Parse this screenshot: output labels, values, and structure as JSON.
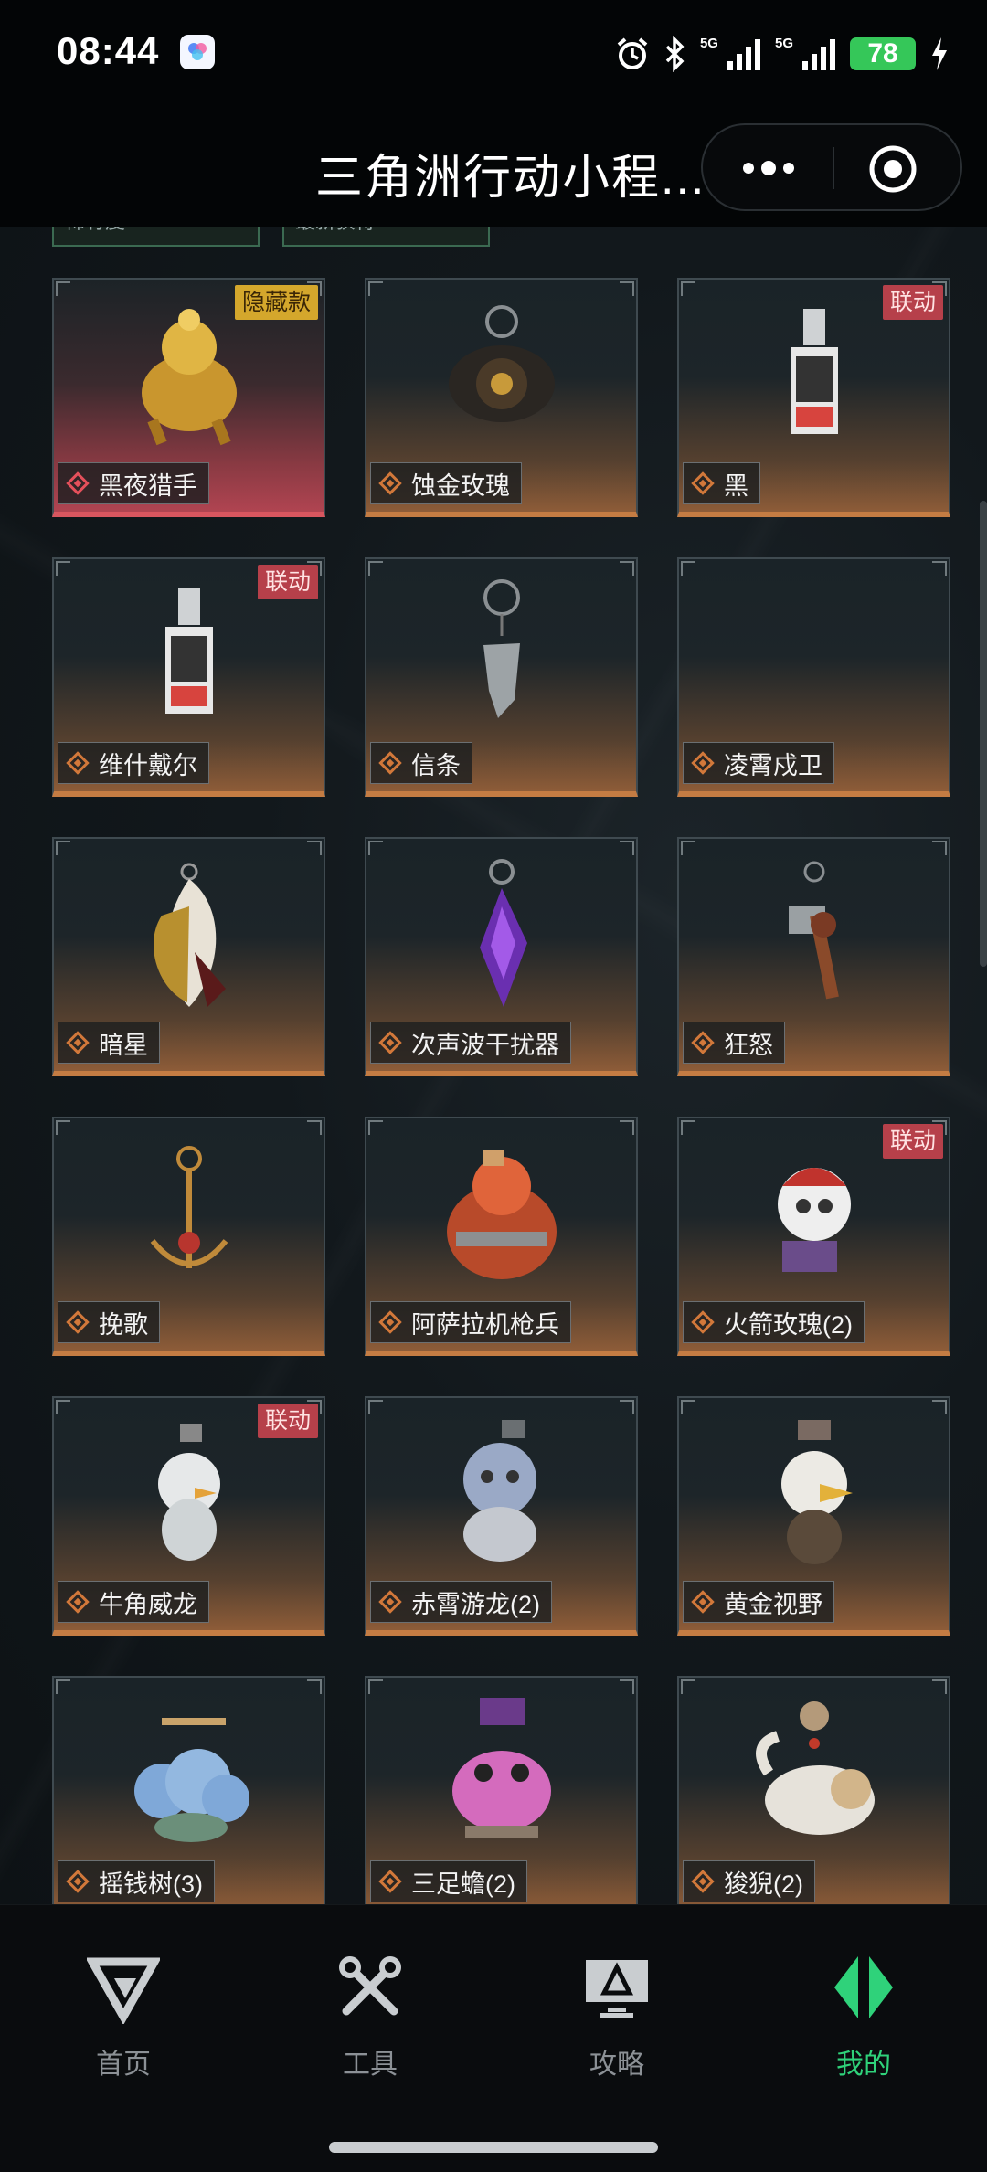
{
  "status_bar": {
    "time": "08:44",
    "battery": "78",
    "net1": "5G",
    "net2": "5G"
  },
  "title_bar": {
    "title": "三角洲行动小程..."
  },
  "filters": [
    "稀有度",
    "最新获得"
  ],
  "items": [
    {
      "name": "黑夜猎手",
      "tag": "隐藏款",
      "tag_type": "hidden",
      "rarity": "red",
      "art": "gold-lion-icon"
    },
    {
      "name": "蚀金玫瑰",
      "tag": "",
      "tag_type": "",
      "rarity": "orange",
      "art": "rose-pendant-icon"
    },
    {
      "name": "黑",
      "tag": "联动",
      "tag_type": "collab",
      "rarity": "orange",
      "art": "card-pendant-icon"
    },
    {
      "name": "维什戴尔",
      "tag": "联动",
      "tag_type": "collab",
      "rarity": "orange",
      "art": "card-pendant-icon"
    },
    {
      "name": "信条",
      "tag": "",
      "tag_type": "",
      "rarity": "orange",
      "art": "blade-pendant-icon"
    },
    {
      "name": "凌霄戍卫",
      "tag": "",
      "tag_type": "",
      "rarity": "orange",
      "art": "empty"
    },
    {
      "name": "暗星",
      "tag": "",
      "tag_type": "",
      "rarity": "orange",
      "art": "mask-pendant-icon"
    },
    {
      "name": "次声波干扰器",
      "tag": "",
      "tag_type": "",
      "rarity": "orange",
      "art": "crystal-pendant-icon"
    },
    {
      "name": "狂怒",
      "tag": "",
      "tag_type": "",
      "rarity": "orange",
      "art": "hammer-pendant-icon"
    },
    {
      "name": "挽歌",
      "tag": "",
      "tag_type": "",
      "rarity": "orange",
      "art": "anchor-pendant-icon"
    },
    {
      "name": "阿萨拉机枪兵",
      "tag": "",
      "tag_type": "",
      "rarity": "orange",
      "art": "gunner-figure-icon"
    },
    {
      "name": "火箭玫瑰(2)",
      "tag": "联动",
      "tag_type": "collab",
      "rarity": "orange",
      "art": "rocket-figure-icon"
    },
    {
      "name": "牛角威龙",
      "tag": "联动",
      "tag_type": "collab",
      "rarity": "orange",
      "art": "chick-figure-icon"
    },
    {
      "name": "赤霄游龙(2)",
      "tag": "",
      "tag_type": "",
      "rarity": "orange",
      "art": "dragon-figure-icon"
    },
    {
      "name": "黄金视野",
      "tag": "",
      "tag_type": "",
      "rarity": "orange",
      "art": "eagle-figure-icon"
    },
    {
      "name": "摇钱树(3)",
      "tag": "",
      "tag_type": "",
      "rarity": "orange",
      "art": "cloud-figure-icon"
    },
    {
      "name": "三足蟾(2)",
      "tag": "",
      "tag_type": "",
      "rarity": "orange",
      "art": "toad-figure-icon"
    },
    {
      "name": "狻猊(2)",
      "tag": "",
      "tag_type": "",
      "rarity": "orange",
      "art": "lion-figure-icon"
    }
  ],
  "nav": [
    {
      "label": "首页",
      "icon": "home-v-icon",
      "active": false
    },
    {
      "label": "工具",
      "icon": "tools-icon",
      "active": false
    },
    {
      "label": "攻略",
      "icon": "guide-monitor-icon",
      "active": false
    },
    {
      "label": "我的",
      "icon": "profile-diamond-icon",
      "active": true
    }
  ],
  "colors": {
    "accent_green": "#2fd27a",
    "orange_rarity": "#c47c43",
    "red_rarity": "#d8565f",
    "collab_tag": "#b6404a",
    "hidden_tag": "#d4a72c"
  }
}
